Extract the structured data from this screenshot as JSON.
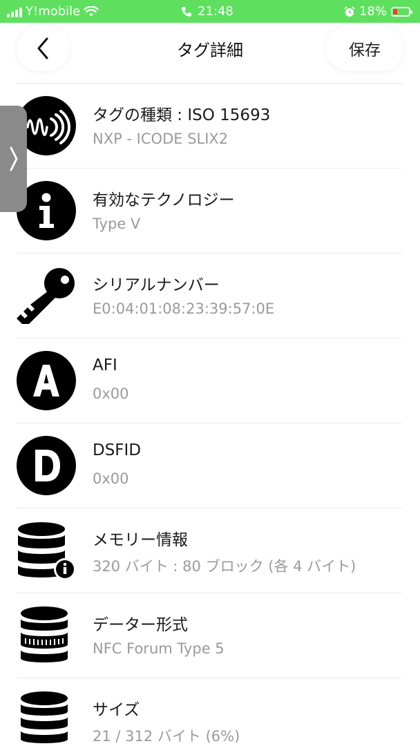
{
  "status_bar": {
    "carrier": "Y!mobile",
    "time": "21:48",
    "battery": "18%",
    "icons": [
      "signal-icon",
      "wifi-icon",
      "phone-icon",
      "alarm-icon",
      "battery-icon"
    ]
  },
  "nav": {
    "title": "タグ詳細",
    "save_label": "保存"
  },
  "rows": [
    {
      "icon": "nfc-wave-icon",
      "title": "タグの種類 : ISO 15693",
      "value": "NXP - ICODE SLIX2"
    },
    {
      "icon": "info-icon",
      "title": "有効なテクノロジー",
      "value": "Type V"
    },
    {
      "icon": "key-icon",
      "title": "シリアルナンバー",
      "value": "E0:04:01:08:23:39:57:0E"
    },
    {
      "icon": "letter-a-icon",
      "title": "AFI",
      "value": "0x00"
    },
    {
      "icon": "letter-d-icon",
      "title": "DSFID",
      "value": "0x00"
    },
    {
      "icon": "database-info-icon",
      "title": "メモリー情報",
      "value": "320 バイト : 80 ブロック (各 4 バイト)"
    },
    {
      "icon": "database-format-icon",
      "title": "データー形式",
      "value": "NFC Forum Type 5"
    },
    {
      "icon": "database-icon",
      "title": "サイズ",
      "value": "21 / 312 バイト (6%)"
    }
  ],
  "colors": {
    "status_bar": "#5ee05e",
    "icon": "#000000",
    "secondary_text": "#9a9a9a",
    "battery_low": "#ff3b30"
  }
}
